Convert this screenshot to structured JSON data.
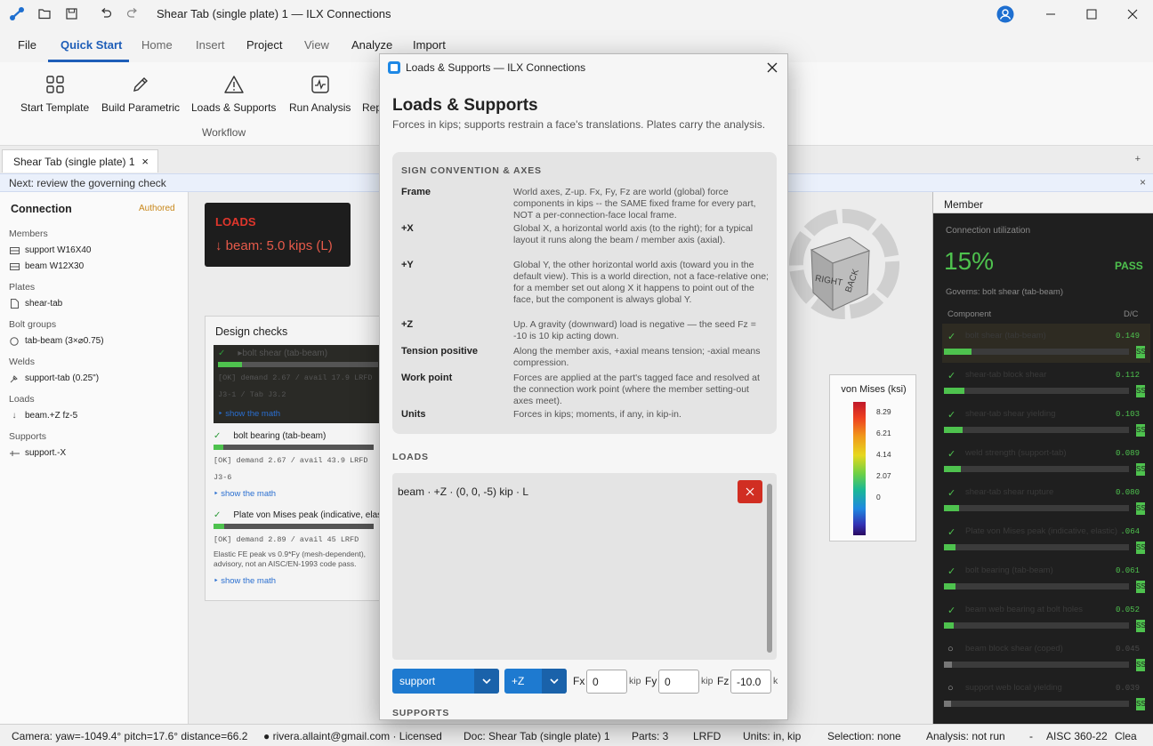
{
  "window": {
    "title": "Shear Tab (single plate) 1 — ILX Connections"
  },
  "menu": {
    "items": [
      "File",
      "Quick Start",
      "Home",
      "Insert",
      "Project",
      "View",
      "Analyze",
      "Import"
    ],
    "active": "Quick Start"
  },
  "ribbon": {
    "buttons": [
      "Start Template",
      "Build Parametric",
      "Loads & Supports",
      "Run Analysis",
      "Rep"
    ],
    "group_label": "Workflow"
  },
  "tabs": {
    "doc_tab": "Shear Tab (single plate) 1",
    "close": "×",
    "add": "+"
  },
  "hint": {
    "text": "Next: review the governing check",
    "close": "×"
  },
  "left_panel": {
    "title": "Connection",
    "badge": "Authored",
    "sections": {
      "members": "Members",
      "plates": "Plates",
      "bolt_groups": "Bolt groups",
      "welds": "Welds",
      "loads": "Loads",
      "supports": "Supports"
    },
    "members": [
      "support  W16X40",
      "beam  W12X30"
    ],
    "plates": [
      "shear-tab"
    ],
    "bolt_groups": [
      "tab-beam (3×⌀0.75)"
    ],
    "welds": [
      "support-tab (0.25\")"
    ],
    "loads": [
      "beam.+Z  fz-5"
    ],
    "supports": [
      "support.-X"
    ]
  },
  "loads_badge": {
    "title": "LOADS",
    "value": "↓ beam:  5.0 kips  (L)"
  },
  "design_checks": {
    "title": "Design checks",
    "items": [
      {
        "name": "bolt shear (tab-beam)",
        "line": "[OK] demand 2.67 / avail 17.9 LRFD",
        "ref": "J3-1 / Tab J3.2",
        "link": "‣ show the math",
        "ratio": 0.149
      },
      {
        "name": "bolt bearing (tab-beam)",
        "line": "[OK] demand 2.67 / avail 43.9 LRFD",
        "ref": "J3-6",
        "link": "‣ show the math",
        "ratio": 0.061
      },
      {
        "name": "Plate von Mises peak (indicative, elastic)",
        "line": "[OK] demand 2.89 / avail 45 LRFD",
        "note1": "Elastic FE peak vs 0.9*Fy (mesh-dependent),",
        "note2": "advisory, not an AISC/EN-1993 code pass.",
        "link": "‣ show the math",
        "ratio": 0.064
      }
    ]
  },
  "viewcube": {
    "faces": [
      "RIGHT",
      "BACK"
    ]
  },
  "legend": {
    "title": "von Mises (ksi)",
    "ticks": [
      "8.29",
      "6.21",
      "4.14",
      "2.07",
      "0"
    ]
  },
  "right_panel": {
    "title": "Member",
    "util_label": "Connection utilization",
    "util_value": "15%",
    "status": "PASS",
    "governs": "Governs: bolt shear (tab-beam)",
    "col_component": "Component",
    "col_dc": "D/C",
    "rows": [
      {
        "mark": "✓",
        "name": "bolt shear (tab-beam)",
        "dc": "0.149",
        "ratio": 0.149,
        "tag": "SS"
      },
      {
        "mark": "✓",
        "name": "shear-tab block shear",
        "dc": "0.112",
        "ratio": 0.112,
        "tag": "SS"
      },
      {
        "mark": "✓",
        "name": "shear-tab shear yielding",
        "dc": "0.103",
        "ratio": 0.103,
        "tag": "SS"
      },
      {
        "mark": "✓",
        "name": "weld strength (support-tab)",
        "dc": "0.089",
        "ratio": 0.089,
        "tag": "SS"
      },
      {
        "mark": "✓",
        "name": "shear-tab shear rupture",
        "dc": "0.080",
        "ratio": 0.08,
        "tag": "SS"
      },
      {
        "mark": "✓",
        "name": "Plate von Mises peak (indicative, elastic)",
        "dc": ".064",
        "ratio": 0.064,
        "tag": "SS"
      },
      {
        "mark": "✓",
        "name": "bolt bearing (tab-beam)",
        "dc": "0.061",
        "ratio": 0.061,
        "tag": "SS"
      },
      {
        "mark": "✓",
        "name": "beam web bearing at bolt holes",
        "dc": "0.052",
        "ratio": 0.052,
        "tag": "SS"
      },
      {
        "mark": "○",
        "name": "beam block shear (coped)",
        "dc": "0.045",
        "ratio": 0.045,
        "tag": "SS"
      },
      {
        "mark": "○",
        "name": "support web local yielding",
        "dc": "0.039",
        "ratio": 0.039,
        "tag": "SS"
      }
    ]
  },
  "status_bar": {
    "camera": "Camera: yaw=-1049.4° pitch=17.6° distance=66.2",
    "user": "● rivera.allaint@gmail.com · Licensed",
    "doc": "Doc: Shear Tab (single plate) 1",
    "parts": "Parts: 3",
    "method": "LRFD",
    "units": "Units: in, kip",
    "selection": "Selection: none",
    "analysis": "Analysis: not run",
    "dash": "-",
    "code": "AISC 360-22",
    "clear": "Clea"
  },
  "dialog": {
    "title": "Loads & Supports — ILX Connections",
    "heading": "Loads & Supports",
    "subtitle": "Forces in kips; supports restrain a face's translations. Plates carry the analysis.",
    "sign_heading": "SIGN CONVENTION & AXES",
    "conventions": [
      {
        "key": "Frame",
        "text": "World axes, Z-up. Fx, Fy, Fz are world (global) force components in kips -- the SAME fixed frame for every part, NOT a per-connection-face local frame."
      },
      {
        "key": "+X",
        "text": "Global X, a horizontal world axis (to the right); for a typical layout it runs along the beam / member axis (axial)."
      },
      {
        "key": "+Y",
        "text": "Global Y, the other horizontal world axis (toward you in the default view). This is a world direction, not a face-relative one; for a member set out along X it happens to point out of the face, but the component is always global Y."
      },
      {
        "key": "+Z",
        "text": "Up. A gravity (downward) load is negative — the seed Fz = -10 is 10 kip acting down."
      },
      {
        "key": "Tension positive",
        "text": "Along the member axis, +axial means tension; -axial means compression."
      },
      {
        "key": "Work point",
        "text": "Forces are applied at the part's tagged face and resolved at the connection work point (where the member setting-out axes meet)."
      },
      {
        "key": "Units",
        "text": "Forces in kips; moments, if any, in kip-in."
      }
    ],
    "loads_heading": "LOADS",
    "load_row": "beam · +Z · (0, 0, -5) kip · L",
    "new_load": {
      "part": "support",
      "face": "+Z",
      "fx_label": "Fx",
      "fx": "0",
      "fy_label": "Fy",
      "fy": "0",
      "fz_label": "Fz",
      "fz": "-10.0",
      "unit": "kip",
      "unit_cut": "k"
    },
    "supports_heading": "SUPPORTS"
  }
}
